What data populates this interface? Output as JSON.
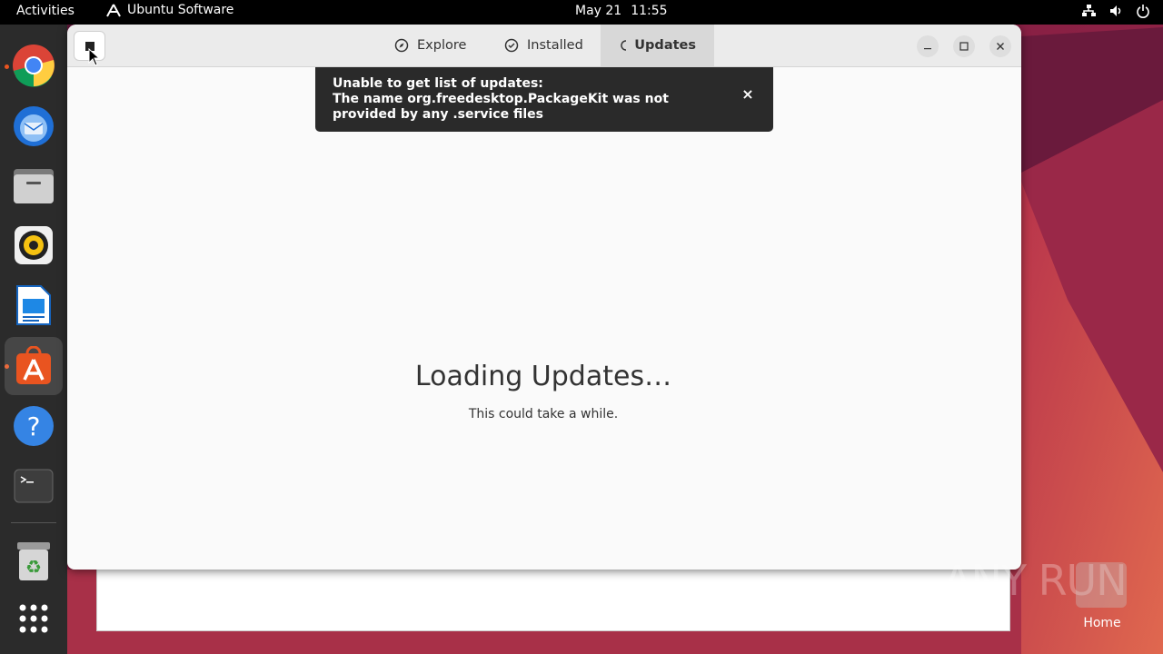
{
  "topbar": {
    "activities": "Activities",
    "app_name": "Ubuntu Software",
    "date": "May 21",
    "time": "11:55"
  },
  "dock": {
    "items": [
      {
        "name": "chrome-icon"
      },
      {
        "name": "thunderbird-icon"
      },
      {
        "name": "files-icon"
      },
      {
        "name": "rhythmbox-icon"
      },
      {
        "name": "libreoffice-writer-icon"
      },
      {
        "name": "ubuntu-software-icon"
      },
      {
        "name": "help-icon"
      },
      {
        "name": "terminal-icon"
      },
      {
        "name": "trash-icon"
      },
      {
        "name": "show-apps-icon"
      }
    ]
  },
  "window": {
    "tabs": [
      {
        "label": "Explore",
        "icon": "compass-icon"
      },
      {
        "label": "Installed",
        "icon": "check-circle-icon"
      },
      {
        "label": "Updates",
        "icon": "refresh-icon"
      }
    ],
    "active_tab": "Updates"
  },
  "notification": {
    "line1": "Unable to get list of updates:",
    "line2": "The name org.freedesktop.PackageKit was not provided by any .service files",
    "close": "×"
  },
  "loading": {
    "title": "Loading Updates…",
    "subtitle": "This could take a while."
  },
  "desktop": {
    "watermark": "ANY RUN",
    "home_label": "Home"
  },
  "colors": {
    "accent": "#e95420",
    "topbar": "#000000",
    "dock": "#2b2b2b"
  }
}
